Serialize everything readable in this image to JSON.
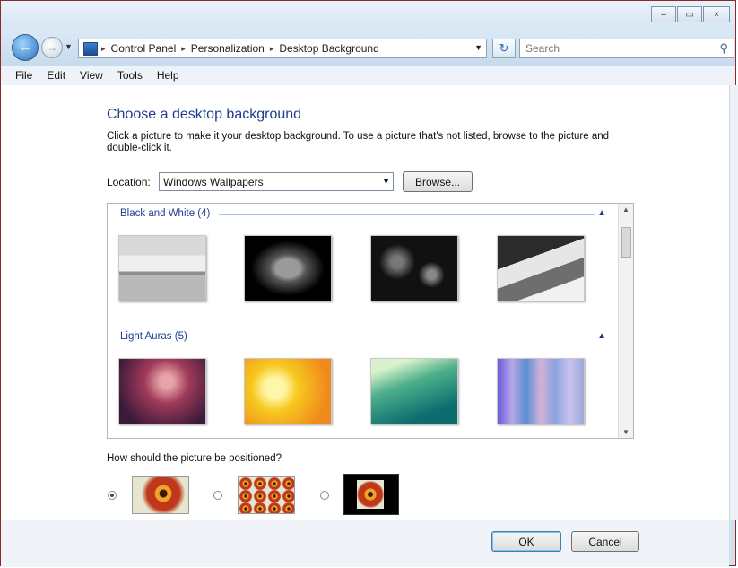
{
  "window": {
    "caption_buttons": {
      "minimize": "–",
      "maximize": "▭",
      "close": "×"
    }
  },
  "nav": {
    "back_icon": "arrow-left-icon",
    "forward_icon": "arrow-right-icon",
    "breadcrumb": [
      "Control Panel",
      "Personalization",
      "Desktop Background"
    ],
    "breadcrumb_separator": "▸",
    "refresh_glyph": "↻",
    "search_placeholder": "Search"
  },
  "menu": [
    "File",
    "Edit",
    "View",
    "Tools",
    "Help"
  ],
  "main": {
    "heading": "Choose a desktop background",
    "instructions": "Click a picture to make it your desktop background. To use a picture that's not listed, browse to the picture and double-click it.",
    "location_label": "Location:",
    "location_value": "Windows Wallpapers",
    "browse_label": "Browse...",
    "groups": [
      {
        "title": "Black and White (4)",
        "collapse_glyph": "▲",
        "thumbnails": [
          "window-seat-bw",
          "leaves-bw",
          "city-lights-bw",
          "coast-trees-bw"
        ]
      },
      {
        "title": "Light Auras (5)",
        "collapse_glyph": "▲",
        "thumbnails": [
          "aura-purple",
          "aura-yellow",
          "aura-teal",
          "aura-stripes"
        ]
      }
    ],
    "position_question": "How should the picture be positioned?",
    "position_options": [
      {
        "name": "fit-to-screen",
        "selected": true
      },
      {
        "name": "tile",
        "selected": false
      },
      {
        "name": "center",
        "selected": false
      }
    ]
  },
  "footer": {
    "ok_label": "OK",
    "cancel_label": "Cancel"
  },
  "colors": {
    "heading": "#1e3d8f",
    "window_border": "#8a2a2a",
    "chrome": "#cfe0ef"
  }
}
